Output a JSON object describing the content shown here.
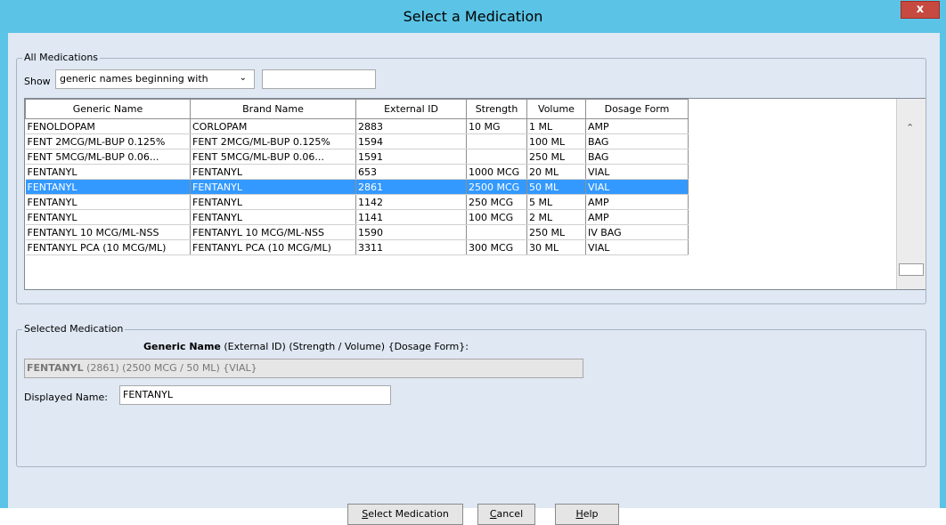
{
  "window": {
    "title": "Select a Medication",
    "close_label": "x"
  },
  "all_medications": {
    "legend": "All Medications",
    "show_label": "Show",
    "filter_select": "generic names beginning with",
    "filter_value": "",
    "columns": [
      "Generic Name",
      "Brand Name",
      "External ID",
      "Strength",
      "Volume",
      "Dosage Form"
    ],
    "rows": [
      {
        "generic": "FENOLDOPAM",
        "brand": "CORLOPAM",
        "ext_id": "2883",
        "strength": "10 MG",
        "volume": "1 ML",
        "form": "AMP"
      },
      {
        "generic": "FENT 2MCG/ML-BUP 0.125%",
        "brand": "FENT 2MCG/ML-BUP 0.125%",
        "ext_id": "1594",
        "strength": "",
        "volume": "100 ML",
        "form": "BAG"
      },
      {
        "generic": "FENT 5MCG/ML-BUP 0.06...",
        "brand": "FENT 5MCG/ML-BUP 0.06...",
        "ext_id": "1591",
        "strength": "",
        "volume": "250 ML",
        "form": "BAG"
      },
      {
        "generic": "FENTANYL",
        "brand": "FENTANYL",
        "ext_id": "653",
        "strength": "1000 MCG",
        "volume": "20 ML",
        "form": "VIAL"
      },
      {
        "generic": "FENTANYL",
        "brand": "FENTANYL",
        "ext_id": "2861",
        "strength": "2500 MCG",
        "volume": "50 ML",
        "form": "VIAL"
      },
      {
        "generic": "FENTANYL",
        "brand": "FENTANYL",
        "ext_id": "1142",
        "strength": "250 MCG",
        "volume": "5 ML",
        "form": "AMP"
      },
      {
        "generic": "FENTANYL",
        "brand": "FENTANYL",
        "ext_id": "1141",
        "strength": "100 MCG",
        "volume": "2 ML",
        "form": "AMP"
      },
      {
        "generic": "FENTANYL 10 MCG/ML-NSS",
        "brand": "FENTANYL 10 MCG/ML-NSS",
        "ext_id": "1590",
        "strength": "",
        "volume": "250 ML",
        "form": "IV BAG"
      },
      {
        "generic": "FENTANYL PCA (10 MCG/ML)",
        "brand": "FENTANYL PCA (10 MCG/ML)",
        "ext_id": "3311",
        "strength": "300 MCG",
        "volume": "30 ML",
        "form": "VIAL"
      }
    ],
    "selected_row": 4
  },
  "selected_medication": {
    "legend": "Selected Medication",
    "caption_bold": "Generic Name",
    "caption_rest": " (External ID)  (Strength / Volume)  {Dosage Form}:",
    "summary_bold": "FENTANYL",
    "summary_rest": " (2861) (2500 MCG / 50 ML) {VIAL}",
    "displayed_name_label": "Displayed Name:",
    "displayed_name_value": "FENTANYL"
  },
  "buttons": {
    "select_mnemonic": "S",
    "select_rest": "elect Medication",
    "cancel_mnemonic": "C",
    "cancel_rest": "ancel",
    "help_mnemonic": "H",
    "help_rest": "elp"
  }
}
